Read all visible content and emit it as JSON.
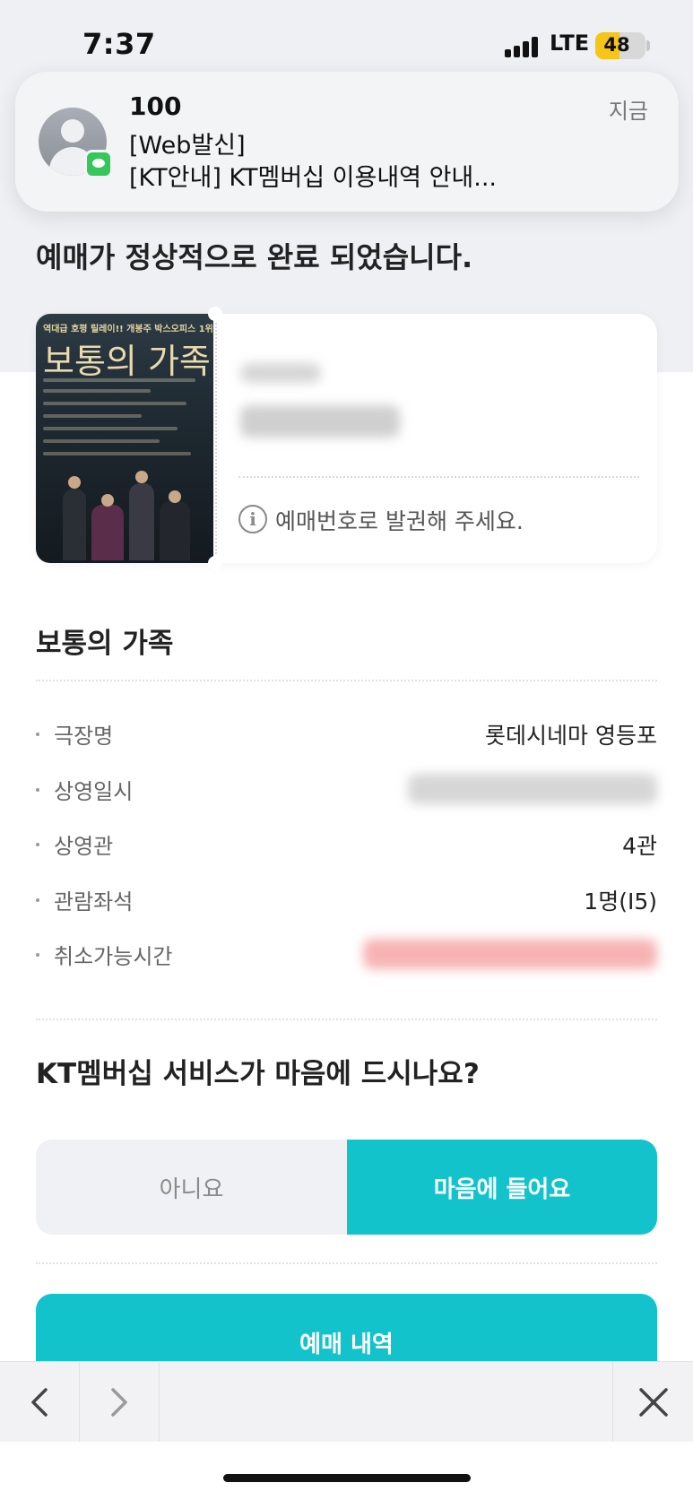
{
  "status_bar": {
    "time": "7:37",
    "network": "LTE",
    "battery": "48",
    "battery_level": 0.48,
    "battery_color": "#f5c518"
  },
  "notification": {
    "sender": "100",
    "time": "지금",
    "line1": "[Web발신]",
    "line2": "[KT안내] KT멤버십 이용내역 안내...",
    "app_icon": "messages-icon"
  },
  "page": {
    "heading": "예매가 정상적으로 완료 되었습니다.",
    "ticket_notice": "예매번호로 발권해 주세요.",
    "poster": {
      "tagline": "역대급 호평 릴레이!! 개봉주 박스오피스 1위!",
      "title": "보통의 가족"
    },
    "movie_title": "보통의 가족",
    "details": [
      {
        "label": "극장명",
        "value": "롯데시네마 영등포"
      },
      {
        "label": "상영일시",
        "value": ""
      },
      {
        "label": "상영관",
        "value": "4관"
      },
      {
        "label": "관람좌석",
        "value": "1명(I5)"
      },
      {
        "label": "취소가능시간",
        "value": ""
      }
    ],
    "survey": {
      "question": "KT멤버십 서비스가 마음에 드시나요?",
      "no_label": "아니요",
      "yes_label": "마음에 들어요"
    },
    "booking_history_label": "예매 내역"
  },
  "browser_toolbar": {
    "back_icon": "chevron-left-icon",
    "forward_icon": "chevron-right-icon",
    "close_icon": "close-icon"
  },
  "colors": {
    "accent": "#13c3cc",
    "background_band": "#eef0f3",
    "redacted_red": "#f7b3b3"
  }
}
